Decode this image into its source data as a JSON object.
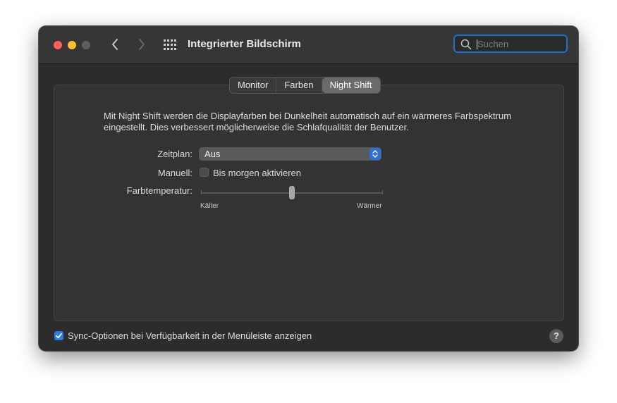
{
  "window": {
    "title": "Integrierter Bildschirm",
    "traffic_lights": {
      "close": "#fe5f57",
      "minimize": "#febc2e",
      "zoom": "#5e5e5e"
    },
    "icons": {
      "back": "chevron-left-icon",
      "forward": "chevron-right-icon",
      "show_all": "grid-icon",
      "search": "magnifier-icon"
    }
  },
  "search": {
    "placeholder": "Suchen",
    "value": ""
  },
  "tabs": [
    {
      "label": "Monitor",
      "active": false
    },
    {
      "label": "Farben",
      "active": false
    },
    {
      "label": "Night Shift",
      "active": true
    }
  ],
  "night_shift": {
    "description": "Mit Night Shift werden die Displayfarben bei Dunkelheit automatisch auf ein wärmeres Farbspektrum eingestellt. Dies verbessert möglicherweise die Schlafqualität der Benutzer.",
    "schedule_label": "Zeitplan:",
    "schedule_value": "Aus",
    "manual_label": "Manuell:",
    "manual_checkbox_label": "Bis morgen aktivieren",
    "manual_checked": false,
    "temperature_label": "Farbtemperatur:",
    "temperature_min_label": "Kälter",
    "temperature_max_label": "Wärmer",
    "temperature_value": 0.5
  },
  "footer": {
    "sync_label": "Sync-Optionen bei Verfügbarkeit in der Menüleiste anzeigen",
    "sync_checked": true,
    "help_label": "?"
  },
  "colors": {
    "accent": "#2f7be5",
    "focus_ring": "#1e6fd0"
  }
}
